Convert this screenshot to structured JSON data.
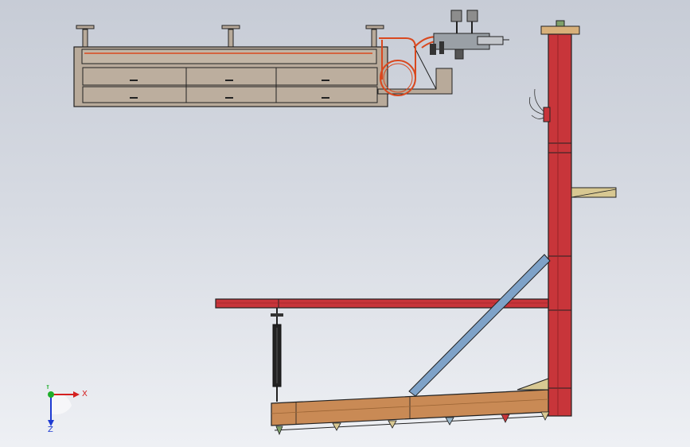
{
  "viewport": {
    "background_top": "#c7ccd6",
    "background_bottom": "#eef0f4"
  },
  "triad": {
    "x_label": "X",
    "y_label": "Y",
    "z_label": "Z",
    "x_color": "#d42020",
    "y_color": "#1fae2a",
    "z_color": "#1e3bd2"
  },
  "colors": {
    "frame_red": "#c8353a",
    "housing_gray": "#b8aa9a",
    "wood_brown": "#c98a55",
    "brace_blue": "#7ea2c8",
    "tube_orange": "#d9481f",
    "bracket_beige": "#d8c892",
    "cylinder_black": "#222222"
  },
  "icons": {
    "triad": "coordinate-triad-icon",
    "view_cube_hint": "axis-origin-icon"
  }
}
